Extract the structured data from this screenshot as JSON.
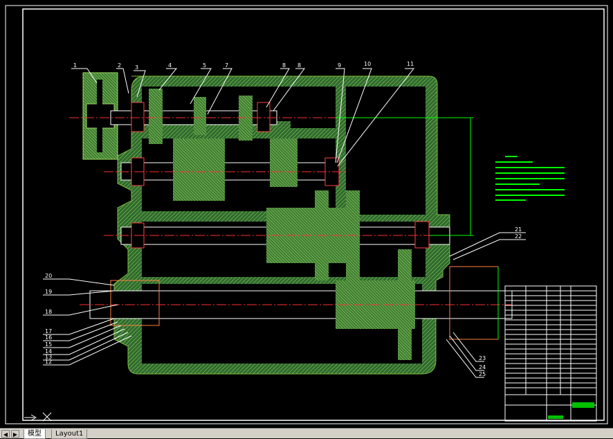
{
  "balloons": [
    "1",
    "2",
    "3",
    "4",
    "5",
    "7",
    "8",
    "8",
    "9",
    "10",
    "11"
  ],
  "left_labels": [
    "20",
    "19",
    "18",
    "17",
    "16",
    "15",
    "14",
    "13",
    "12"
  ],
  "right_labels": [
    "21",
    "22",
    "23",
    "24",
    "25"
  ],
  "colors": {
    "background": "#000000",
    "frame": "#ffffff",
    "housing": "#3c7a3c",
    "hatch": "#7fbf3f",
    "centerline": "#ff3030",
    "leader": "#ffffff",
    "dimension": "#00ff00",
    "bearing": "#ff4040"
  },
  "tabs": {
    "model": "模型",
    "layout": "Layout1"
  },
  "nav": {
    "prev": "◀",
    "next": "▶"
  }
}
